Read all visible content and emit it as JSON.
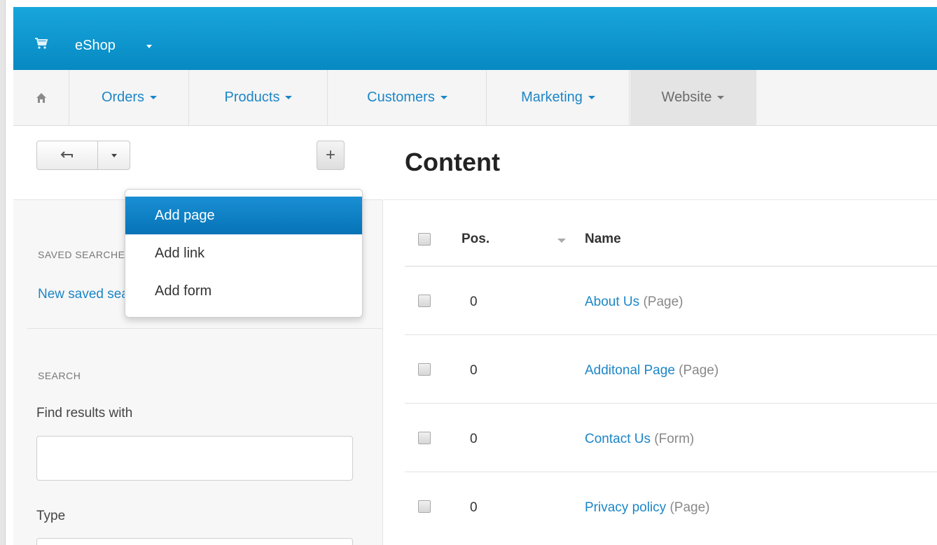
{
  "topbar": {
    "store_name": "eShop",
    "icon": "shopping-cart-icon",
    "background": "#0e98cf"
  },
  "nav": {
    "home_icon": "home-icon",
    "items": [
      {
        "label": "Orders"
      },
      {
        "label": "Products"
      },
      {
        "label": "Customers"
      },
      {
        "label": "Marketing"
      },
      {
        "label": "Website",
        "active": true
      }
    ]
  },
  "toolbar": {
    "back_icon": "back-arrow-icon",
    "add_label": "+"
  },
  "dropdown": {
    "items": [
      {
        "label": "Add page",
        "selected": true
      },
      {
        "label": "Add link"
      },
      {
        "label": "Add form"
      }
    ]
  },
  "sidebar": {
    "saved_searches_label": "SAVED SEARCHES",
    "saved_search_link": "New saved search",
    "search_label": "SEARCH",
    "find_label": "Find results with",
    "find_value": "",
    "type_label": "Type"
  },
  "main": {
    "title": "Content",
    "columns": {
      "pos": "Pos.",
      "name": "Name"
    },
    "rows": [
      {
        "pos": "0",
        "name": "About Us",
        "kind": "(Page)"
      },
      {
        "pos": "0",
        "name": "Additonal Page",
        "kind": "(Page)"
      },
      {
        "pos": "0",
        "name": "Contact Us",
        "kind": "(Form)"
      },
      {
        "pos": "0",
        "name": "Privacy policy",
        "kind": "(Page)"
      }
    ]
  },
  "colors": {
    "accent": "#1c86c7",
    "selected_item": "#0a7bc1"
  }
}
